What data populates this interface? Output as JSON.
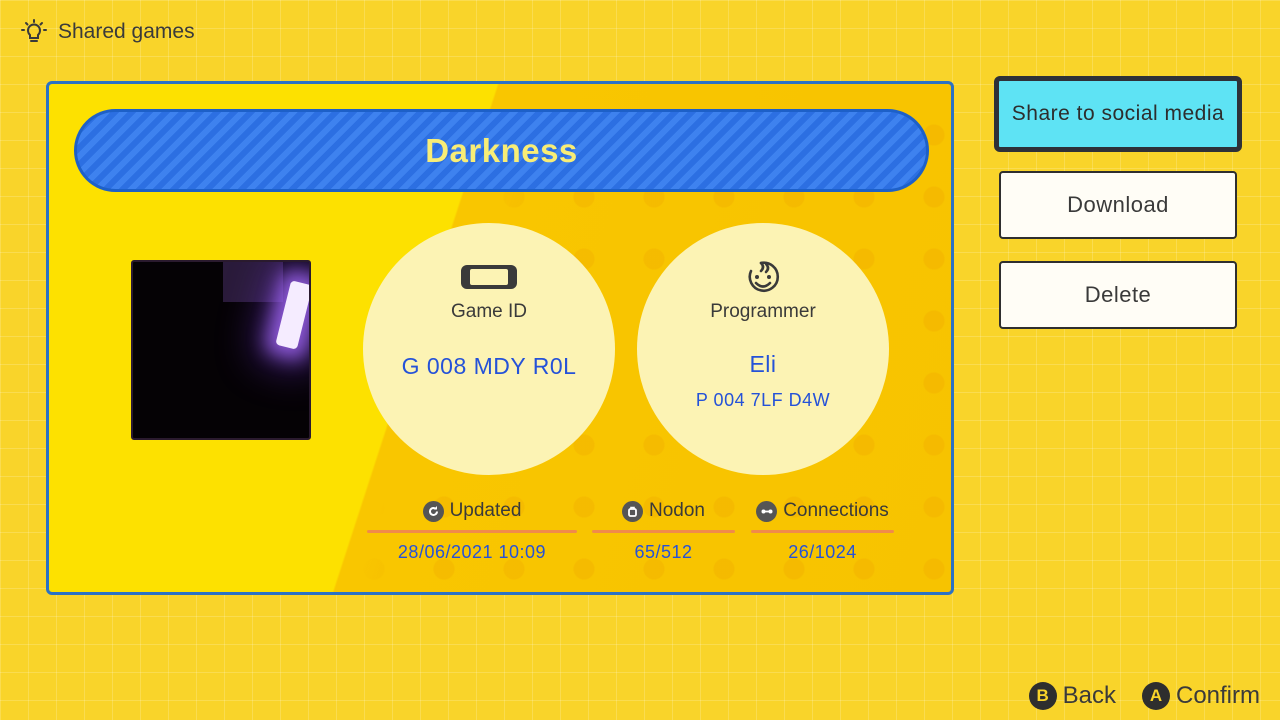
{
  "header": {
    "title": "Shared games",
    "icon": "lightbulb-icon"
  },
  "game": {
    "title": "Darkness",
    "game_id_label": "Game ID",
    "game_id": "G 008 MDY R0L",
    "programmer_label": "Programmer",
    "programmer_name": "Eli",
    "programmer_id": "P 004 7LF D4W"
  },
  "stats": {
    "updated_label": "Updated",
    "updated_value": "28/06/2021 10:09",
    "nodon_label": "Nodon",
    "nodon_value": "65/512",
    "connections_label": "Connections",
    "connections_value": "26/1024"
  },
  "actions": {
    "share_label": "Share to social media",
    "download_label": "Download",
    "delete_label": "Delete"
  },
  "footer": {
    "back_button": "B",
    "back_label": "Back",
    "confirm_button": "A",
    "confirm_label": "Confirm"
  },
  "colors": {
    "background": "#f9d42a",
    "title_bar": "#2c6fe2",
    "title_text": "#f8ed76",
    "value_text": "#2552d8",
    "share_highlight": "#5ee3f4",
    "card_border": "#2b72c4"
  }
}
